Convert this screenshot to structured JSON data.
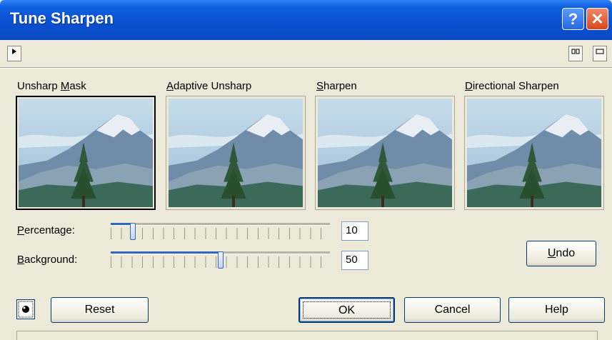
{
  "window": {
    "title": "Tune Sharpen"
  },
  "titlebar_buttons": {
    "help": "?",
    "close": "✕"
  },
  "toolbar": {
    "expand_icon": "triangle-right",
    "view_split_icon": "split-view",
    "view_single_icon": "single-view"
  },
  "previews": [
    {
      "label_pre": "Unsharp ",
      "label_u": "M",
      "label_post": "ask",
      "selected": true
    },
    {
      "label_pre": "",
      "label_u": "A",
      "label_post": "daptive Unsharp",
      "selected": false
    },
    {
      "label_pre": "",
      "label_u": "S",
      "label_post": "harpen",
      "selected": false
    },
    {
      "label_pre": "",
      "label_u": "D",
      "label_post": "irectional Sharpen",
      "selected": false
    }
  ],
  "controls": {
    "percentage": {
      "label_u": "P",
      "label_rest": "ercentage:",
      "value": "10",
      "fraction": 0.1
    },
    "background": {
      "label_u": "B",
      "label_rest": "ackground:",
      "value": "50",
      "fraction": 0.5
    }
  },
  "buttons": {
    "undo_u": "U",
    "undo_rest": "ndo",
    "reset": "Reset",
    "ok": "OK",
    "cancel": "Cancel",
    "help": "Help"
  }
}
